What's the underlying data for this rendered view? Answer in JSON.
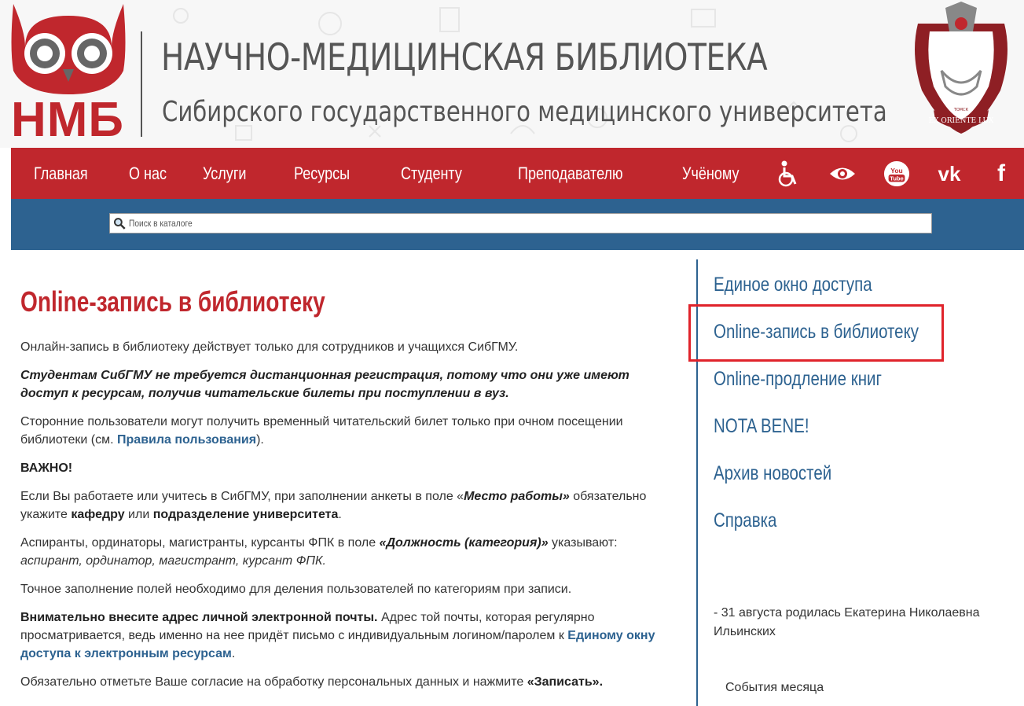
{
  "header": {
    "logo_abbr": "НМБ",
    "title_main": "НАУЧНО-МЕДИЦИНСКАЯ БИБЛИОТЕКА",
    "title_sub": "Сибирского государственного медицинского университета",
    "crest_motto": "EX ORIENTE LUX",
    "crest_city": "ТОМСК"
  },
  "nav": {
    "items": [
      "Главная",
      "О нас",
      "Услуги",
      "Ресурсы",
      "Студенту",
      "Преподавателю",
      "Учёному"
    ],
    "icons": [
      "accessibility-icon",
      "eye-icon",
      "youtube-icon",
      "vk-icon",
      "facebook-icon"
    ],
    "youtube_label": "You Tube",
    "vk_label": "vk",
    "facebook_label": "f"
  },
  "search": {
    "placeholder": "Поиск в каталоге"
  },
  "main": {
    "title": "Online-запись в библиотеку",
    "p1": "Онлайн-запись в библиотеку действует только для сотрудников и учащихся СибГМУ.",
    "p2": "Студентам СибГМУ не требуется дистанционная регистрация, потому что они уже имеют доступ к ресурсам, получив читательские билеты при поступлении в вуз.",
    "p3_a": "Сторонние пользователи могут получить временный читательский билет только при очном посещении библиотеки (см. ",
    "p3_link": "Правила пользования",
    "p3_b": ").",
    "important": "ВАЖНО!",
    "p5_a": "Если Вы работаете или учитесь в СибГМУ, при заполнении анкеты в поле «",
    "p5_field": "Место работы»",
    "p5_b": " обязательно укажите ",
    "p5_dept": "кафедру",
    "p5_c": " или ",
    "p5_unit": "подразделение университета",
    "p5_d": ".",
    "p6_a": "Аспиранты, ординаторы, магистранты, курсанты ФПК в поле ",
    "p6_field": "«Должность (категория)»",
    "p6_b": " указывают: ",
    "p6_values": "аспирант, ординатор, магистрант, курсант ФПК.",
    "p7": "Точное заполнение полей необходимо для деления пользователей по категориям при записи.",
    "p8_bold": "Внимательно внесите адрес личной электронной почты.",
    "p8_a": " Адрес той почты, которая регулярно просматривается, ведь именно на нее придёт письмо с индивидуальным логином/паролем к ",
    "p8_link": "Единому окну доступа к электронным ресурсам",
    "p8_b": ".",
    "p9_a": "Обязательно отметьте Ваше согласие на обработку персональных данных и нажмите ",
    "p9_btn": "«Записать»."
  },
  "sidebar": {
    "links": [
      "Единое окно доступа",
      "Online-запись в библиотеку",
      "Online-продление книг",
      "NOTA BENE!",
      "Архив новостей",
      "Справка"
    ],
    "news": "- 31 августа родилась Екатерина Николаевна Ильинских",
    "events": "События месяца"
  },
  "colors": {
    "brand_red": "#c0272d",
    "brand_blue": "#2d6290",
    "highlight_box": "#e0232b"
  }
}
